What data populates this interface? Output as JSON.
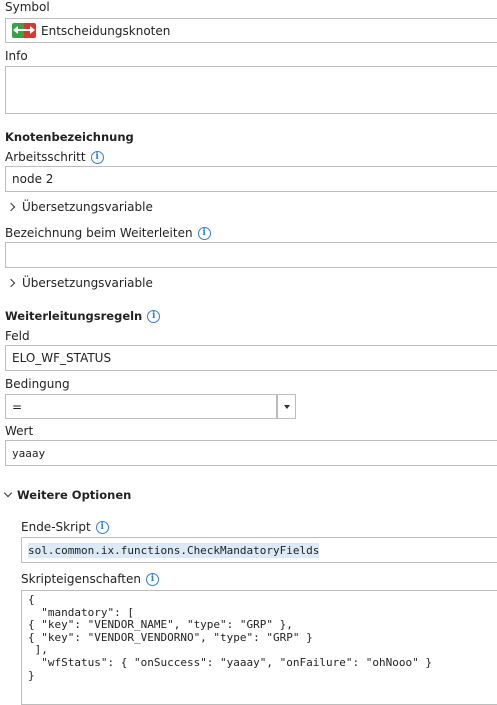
{
  "symbol": {
    "label": "Symbol",
    "value": "Entscheidungsknoten",
    "icon": "decision-node-icon"
  },
  "info": {
    "label": "Info",
    "value": ""
  },
  "node_naming": {
    "title": "Knotenbezeichnung",
    "step_label": "Arbeitsschritt",
    "step_value": "node 2",
    "translation_toggle": "Übersetzungsvariable",
    "forward_label": "Bezeichnung beim Weiterleiten",
    "forward_value": "",
    "forward_translation_toggle": "Übersetzungsvariable"
  },
  "forward_rules": {
    "title": "Weiterleitungsregeln",
    "field_label": "Feld",
    "field_value": "ELO_WF_STATUS",
    "condition_label": "Bedingung",
    "condition_value": "=",
    "value_label": "Wert",
    "value_value": "yaaay"
  },
  "more_options": {
    "title": "Weitere Optionen",
    "end_script_label": "Ende-Skript",
    "end_script_value": "sol.common.ix.functions.CheckMandatoryFields",
    "script_props_label": "Skripteigenschaften",
    "script_props_value": "{\n  \"mandatory\": [\n{ \"key\": \"VENDOR_NAME\", \"type\": \"GRP\" },\n{ \"key\": \"VENDOR_VENDORNO\", \"type\": \"GRP\" }\n ],\n  \"wfStatus\": { \"onSuccess\": \"yaaay\", \"onFailure\": \"ohNooo\" }\n}"
  },
  "colors": {
    "info_icon": "#2f7fcf",
    "border": "#bdbdbd",
    "highlight": "#dce9f7"
  }
}
